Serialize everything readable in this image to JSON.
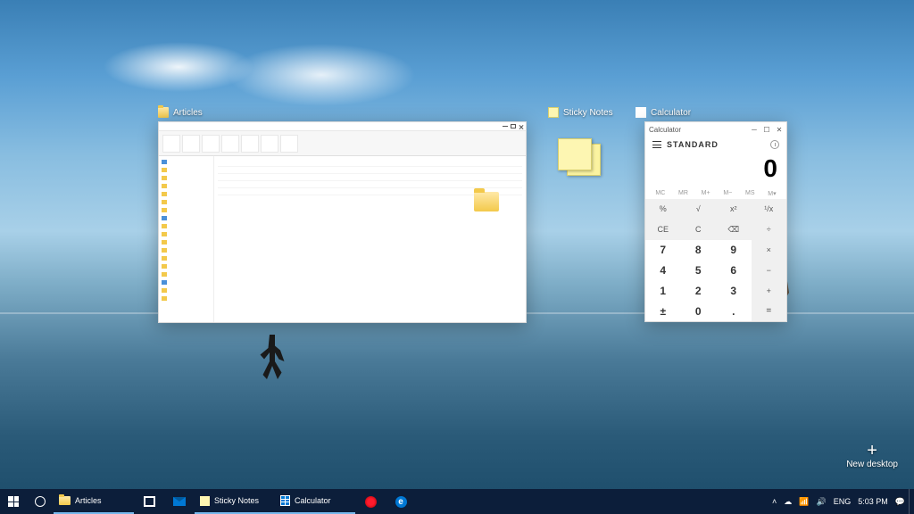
{
  "taskview": {
    "windows": [
      {
        "title": "Articles",
        "type": "explorer"
      },
      {
        "title": "Sticky Notes",
        "type": "sticky"
      },
      {
        "title": "Calculator",
        "type": "calculator"
      }
    ],
    "new_desktop_label": "New desktop"
  },
  "calculator": {
    "app_title": "Calculator",
    "mode": "STANDARD",
    "display": "0",
    "memory_row": [
      "MC",
      "MR",
      "M+",
      "M−",
      "MS",
      "M▾"
    ],
    "buttons": [
      {
        "l": "%",
        "c": "fn"
      },
      {
        "l": "√",
        "c": "fn"
      },
      {
        "l": "x²",
        "c": "fn"
      },
      {
        "l": "¹/x",
        "c": "fn"
      },
      {
        "l": "CE",
        "c": "fn"
      },
      {
        "l": "C",
        "c": "fn"
      },
      {
        "l": "⌫",
        "c": "fn"
      },
      {
        "l": "÷",
        "c": "fn"
      },
      {
        "l": "7",
        "c": "num"
      },
      {
        "l": "8",
        "c": "num"
      },
      {
        "l": "9",
        "c": "num"
      },
      {
        "l": "×",
        "c": "fn"
      },
      {
        "l": "4",
        "c": "num"
      },
      {
        "l": "5",
        "c": "num"
      },
      {
        "l": "6",
        "c": "num"
      },
      {
        "l": "−",
        "c": "fn"
      },
      {
        "l": "1",
        "c": "num"
      },
      {
        "l": "2",
        "c": "num"
      },
      {
        "l": "3",
        "c": "num"
      },
      {
        "l": "+",
        "c": "fn"
      },
      {
        "l": "±",
        "c": "num"
      },
      {
        "l": "0",
        "c": "num"
      },
      {
        "l": ".",
        "c": "num"
      },
      {
        "l": "=",
        "c": "eq"
      }
    ]
  },
  "taskbar": {
    "apps": [
      {
        "name": "articles",
        "label": "Articles",
        "icon": "folder"
      },
      {
        "name": "store",
        "label": "",
        "icon": "store"
      },
      {
        "name": "mail",
        "label": "",
        "icon": "mail"
      },
      {
        "name": "sticky",
        "label": "Sticky Notes",
        "icon": "note"
      },
      {
        "name": "calculator",
        "label": "Calculator",
        "icon": "calc"
      },
      {
        "name": "opera",
        "label": "",
        "icon": "opera"
      },
      {
        "name": "edge",
        "label": "",
        "icon": "edge"
      }
    ],
    "tray": {
      "lang": "ENG",
      "time": "5:03 PM"
    }
  }
}
